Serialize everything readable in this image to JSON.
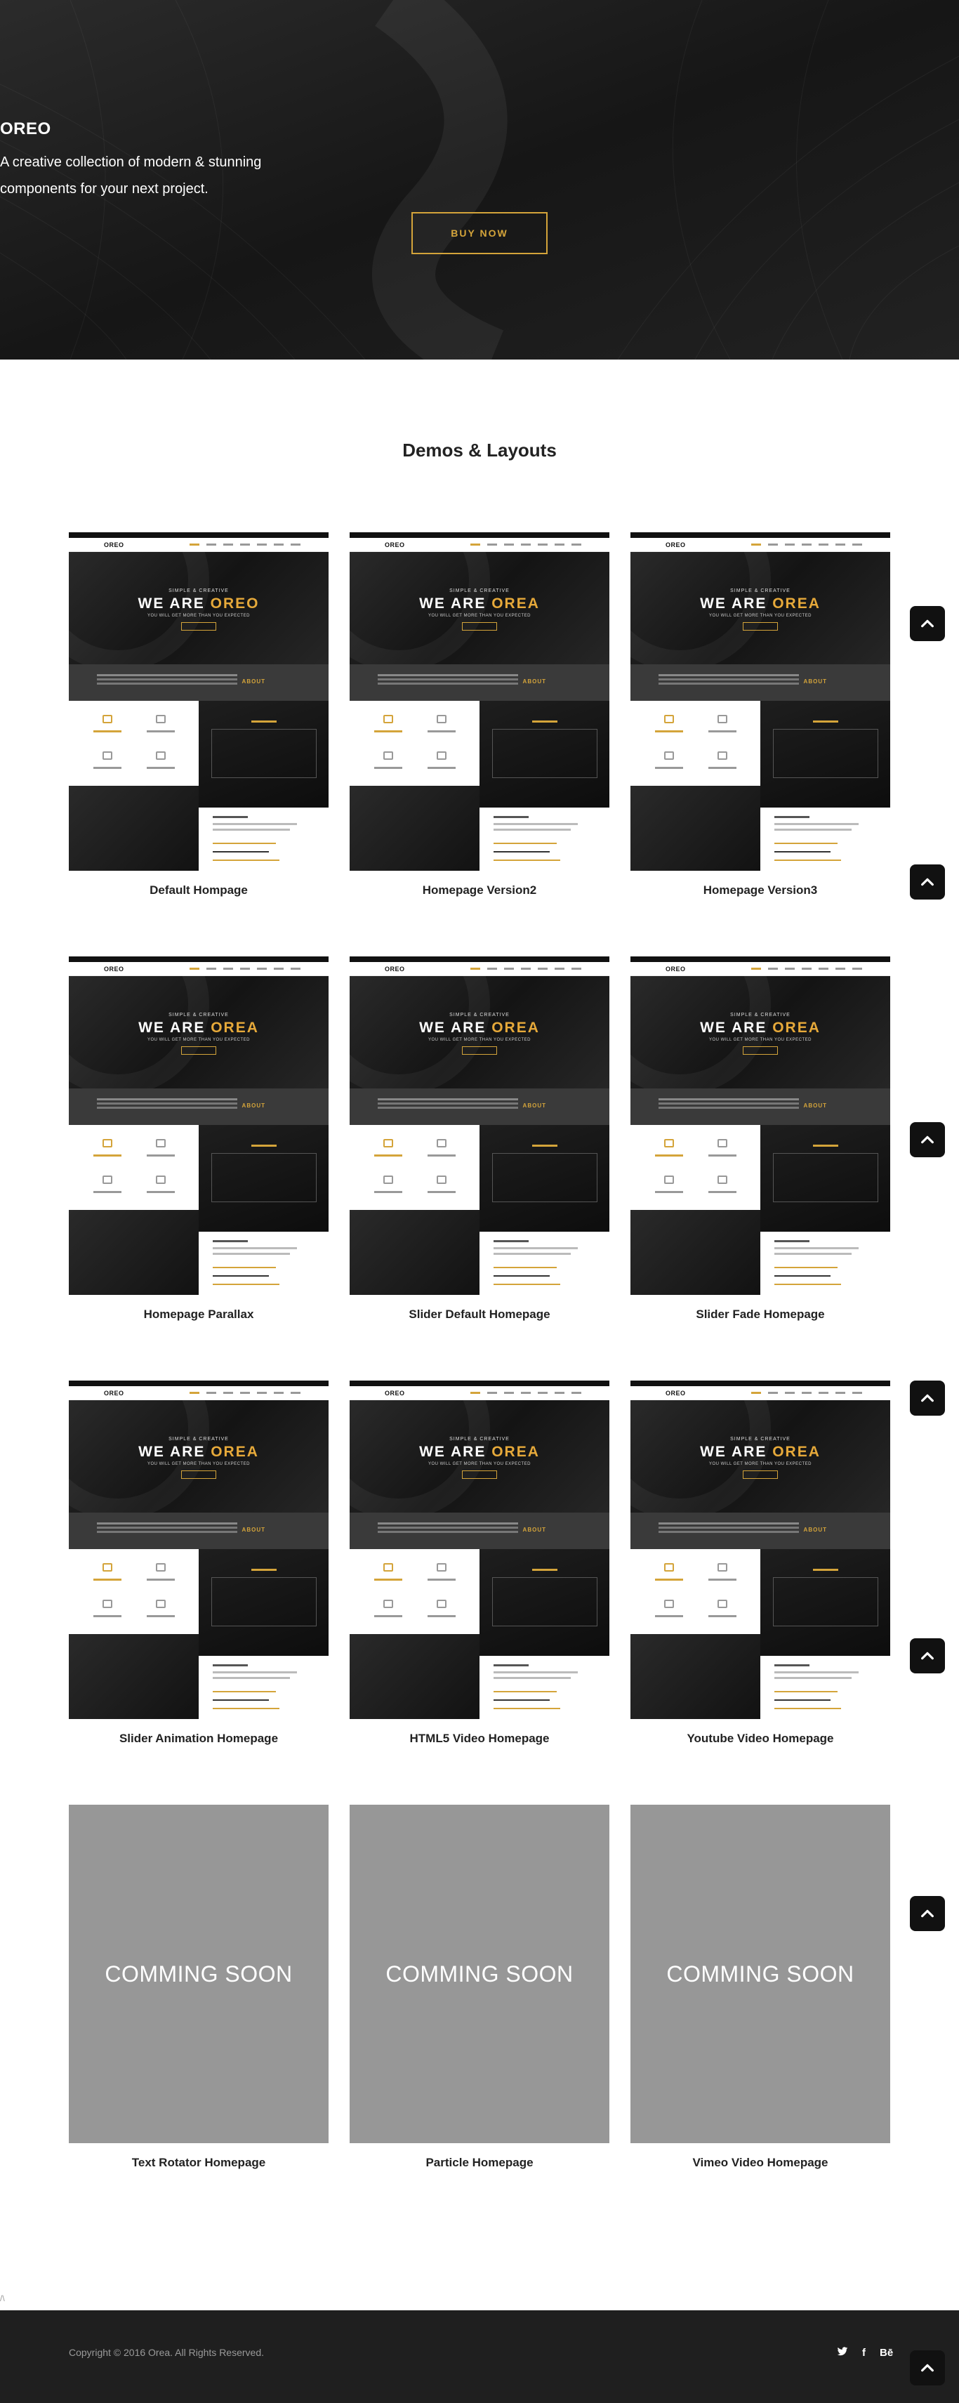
{
  "hero": {
    "title": "OREO",
    "tagline_line1": "A creative collection of modern & stunning",
    "tagline_line2": "components for your next project.",
    "buy_label": "BUY NOW"
  },
  "section": {
    "title": "Demos & Layouts"
  },
  "preview": {
    "logo": "OREO",
    "small": "SIMPLE & CREATIVE",
    "big_prefix": "WE ARE",
    "big_accent_default": "OREO",
    "big_accent": "OREA",
    "sub": "YOU WILL GET MORE THAN YOU EXPECTED",
    "about": "ABOUT"
  },
  "demos": [
    {
      "label": "Default Hompage",
      "preview": true
    },
    {
      "label": "Homepage Version2",
      "preview": true
    },
    {
      "label": "Homepage Version3",
      "preview": true
    },
    {
      "label": "Homepage Parallax",
      "preview": true
    },
    {
      "label": "Slider Default Homepage",
      "preview": true
    },
    {
      "label": "Slider Fade Homepage",
      "preview": true
    },
    {
      "label": "Slider Animation Homepage",
      "preview": true
    },
    {
      "label": "HTML5 Video Homepage",
      "preview": true
    },
    {
      "label": "Youtube Video Homepage",
      "preview": true
    },
    {
      "label": "Text Rotator Homepage",
      "preview": false,
      "placeholder": "COMMING SOON"
    },
    {
      "label": "Particle Homepage",
      "preview": false,
      "placeholder": "COMMING SOON"
    },
    {
      "label": "Vimeo Video Homepage",
      "preview": false,
      "placeholder": "COMMING SOON"
    }
  ],
  "footer": {
    "copyright": "Copyright © 2016 Orea. All Rights Reserved.",
    "social": [
      {
        "name": "twitter-icon",
        "glyph": "🐦"
      },
      {
        "name": "facebook-icon",
        "glyph": "f"
      },
      {
        "name": "behance-icon",
        "glyph": "Bē"
      }
    ]
  },
  "corner_mark": "/\\",
  "colors": {
    "accent": "#d4a43a",
    "dark": "#1b1b1b",
    "placeholder": "#979797"
  }
}
